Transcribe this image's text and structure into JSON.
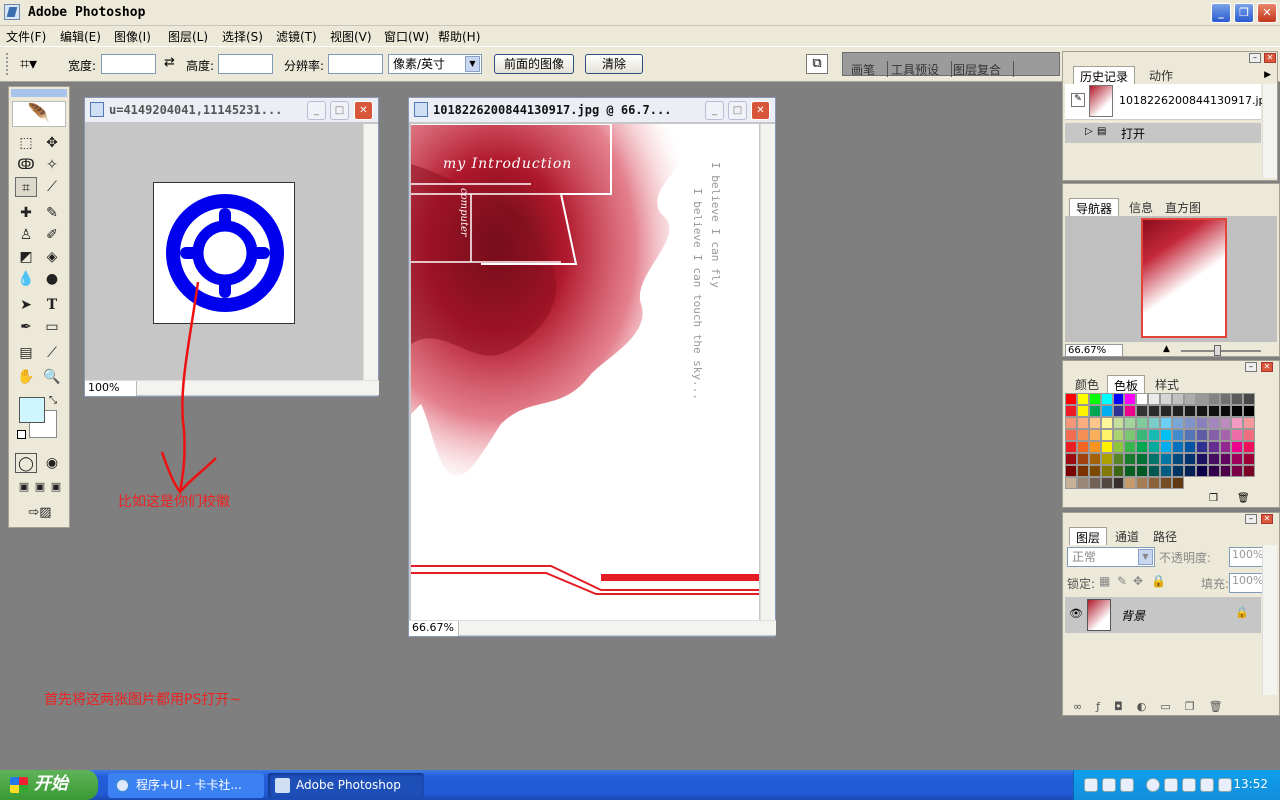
{
  "window": {
    "title": "Adobe Photoshop"
  },
  "menu": [
    "文件(F)",
    "编辑(E)",
    "图像(I)",
    "图层(L)",
    "选择(S)",
    "滤镜(T)",
    "视图(V)",
    "窗口(W)",
    "帮助(H)"
  ],
  "options": {
    "width_label": "宽度:",
    "height_label": "高度:",
    "resolution_label": "分辨率:",
    "unit_value": "像素/英寸",
    "front_image_button": "前面的图像",
    "clear_button": "清除",
    "well_tabs": [
      "画笔",
      "工具预设",
      "图层复合"
    ]
  },
  "doc1": {
    "title": "u=4149204041,11145231...",
    "zoom": "100%",
    "logo_color": "#0000ee"
  },
  "doc2": {
    "title": "1018226200844130917.jpg @ 66.7...",
    "zoom": "66.67%",
    "art": {
      "heading": "my Introduction",
      "vertical_word": "computer",
      "line1": "I believe I can fly",
      "line2": "I believe I can touch the sky..."
    }
  },
  "history_panel": {
    "tabs": [
      "历史记录",
      "动作"
    ],
    "snapshot_name": "1018226200844130917.jpg",
    "step_label": "打开"
  },
  "navigator_panel": {
    "tabs": [
      "导航器",
      "信息",
      "直方图"
    ],
    "zoom": "66.67%"
  },
  "swatches_panel": {
    "tabs": [
      "颜色",
      "色板",
      "样式"
    ],
    "colors": [
      "#ff0000",
      "#ffff00",
      "#00ff00",
      "#00ffff",
      "#0000ff",
      "#ff00ff",
      "#ffffff",
      "#ebebeb",
      "#d6d6d6",
      "#c2c2c2",
      "#adadad",
      "#999999",
      "#858585",
      "#707070",
      "#5c5c5c",
      "#474747",
      "#ed1c24",
      "#fff200",
      "#00a651",
      "#00aeef",
      "#2e3192",
      "#ec008c",
      "#333333",
      "#2b2b2b",
      "#262626",
      "#202020",
      "#1a1a1a",
      "#151515",
      "#101010",
      "#0a0a0a",
      "#050505",
      "#000000",
      "#f7977a",
      "#fbad82",
      "#fdc68c",
      "#fff799",
      "#c6df9c",
      "#a4d49d",
      "#81ca9d",
      "#7bcdc9",
      "#6ccff7",
      "#7ca6d8",
      "#8293ca",
      "#8881be",
      "#a286bd",
      "#bc8cbf",
      "#f49bc1",
      "#f5999d",
      "#f26c4f",
      "#f68e56",
      "#fbaf5b",
      "#fff467",
      "#acd372",
      "#7dc473",
      "#39b778",
      "#16bcb4",
      "#00bff3",
      "#438ccb",
      "#5573b7",
      "#5e5ca7",
      "#855fa8",
      "#a763a9",
      "#ef6ea8",
      "#f16d7e",
      "#ee1d24",
      "#f16522",
      "#f7941d",
      "#fff100",
      "#8fc63d",
      "#37b44a",
      "#00a650",
      "#00a99e",
      "#00aeef",
      "#0072bc",
      "#0054a5",
      "#2f3192",
      "#652c91",
      "#91278f",
      "#ed008c",
      "#ee105a",
      "#9d0a0f",
      "#a1410d",
      "#a36209",
      "#aba000",
      "#588528",
      "#197b30",
      "#007236",
      "#00736a",
      "#0076a4",
      "#004a80",
      "#003370",
      "#1d1363",
      "#450e61",
      "#62055f",
      "#9e005c",
      "#9d0039",
      "#790000",
      "#7b3000",
      "#7c4900",
      "#827a00",
      "#3e6617",
      "#045f20",
      "#005824",
      "#005951",
      "#005b7e",
      "#003562",
      "#002056",
      "#0c004b",
      "#30004a",
      "#4b0048",
      "#7a0045",
      "#7a0026",
      "#c7b299",
      "#998675",
      "#736357",
      "#534741",
      "#362f2d",
      "#c69c6d",
      "#a67c52",
      "#8c6239",
      "#754c24",
      "#603913"
    ]
  },
  "layers_panel": {
    "tabs": [
      "图层",
      "通道",
      "路径"
    ],
    "blend_mode": "正常",
    "opacity_label": "不透明度:",
    "opacity_value": "100%",
    "lock_label": "锁定:",
    "fill_label": "填充:",
    "fill_value": "100%",
    "layer_name": "背景"
  },
  "annotations": {
    "arrow_note": "比如这是你们校徽",
    "bottom_note": "首先将这两张图片都用PS打开~"
  },
  "taskbar": {
    "start": "开始",
    "tasks": [
      "程序+UI - 卡卡社...",
      "Adobe Photoshop"
    ],
    "clock": "13:52"
  }
}
